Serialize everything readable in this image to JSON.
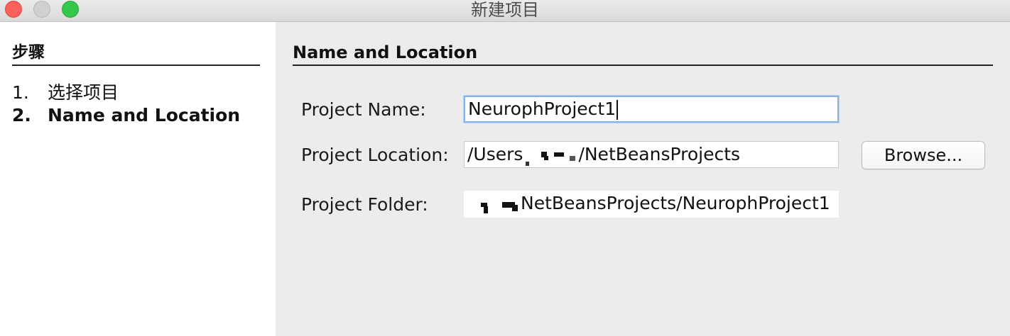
{
  "window": {
    "title": "新建项目"
  },
  "steps": {
    "title": "步骤",
    "items": [
      {
        "number": "1.",
        "label": "选择项目",
        "current": false
      },
      {
        "number": "2.",
        "label": "Name and Location",
        "current": true
      }
    ]
  },
  "content": {
    "section_title": "Name and Location",
    "project_name": {
      "label": "Project Name:",
      "value": "NeurophProject1"
    },
    "project_location": {
      "label": "Project Location:",
      "value_prefix": "/Users",
      "value_suffix": "/NetBeansProjects"
    },
    "project_folder": {
      "label": "Project Folder:",
      "value_suffix": "NetBeansProjects/NeurophProject1"
    },
    "browse_label": "Browse..."
  },
  "colors": {
    "close": "#fc605b",
    "minimize": "#d0d0d0",
    "zoom": "#34c84a",
    "focus_ring": "#89b3e6"
  }
}
